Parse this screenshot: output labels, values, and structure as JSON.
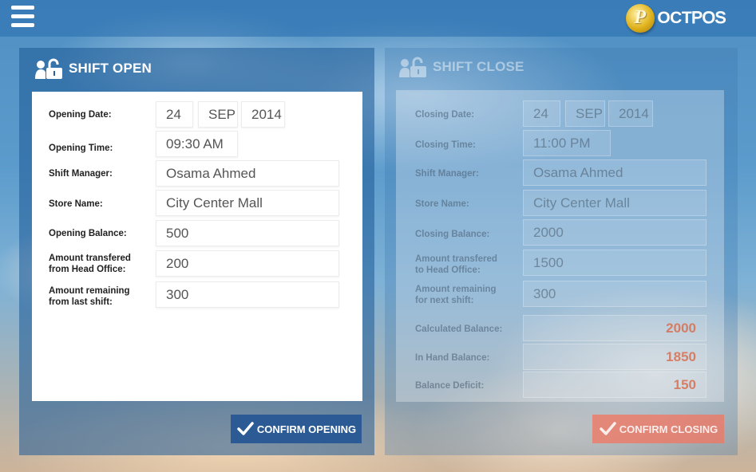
{
  "app": {
    "logo_text_a": "OCT",
    "logo_text_b": "POS"
  },
  "shift_open": {
    "title": "SHIFT OPEN",
    "opening_date": {
      "label": "Opening Date:",
      "day": "24",
      "month": "SEP",
      "year": "2014"
    },
    "opening_time": {
      "label": "Opening Time:",
      "value": "09:30 AM"
    },
    "shift_manager": {
      "label": "Shift Manager:",
      "value": "Osama Ahmed"
    },
    "store_name": {
      "label": "Store Name:",
      "value": "City Center Mall"
    },
    "opening_balance": {
      "label": "Opening Balance:",
      "value": "500"
    },
    "amount_transferred": {
      "label_1": "Amount transfered",
      "label_2": "from Head Office:",
      "value": "200"
    },
    "amount_remaining": {
      "label_1": "Amount remaining",
      "label_2": "from last shift:",
      "value": "300"
    },
    "confirm_label": "CONFIRM OPENING"
  },
  "shift_close": {
    "title": "SHIFT CLOSE",
    "closing_date": {
      "label": "Closing Date:",
      "day": "24",
      "month": "SEP",
      "year": "2014"
    },
    "closing_time": {
      "label": "Closing Time:",
      "value": "11:00 PM"
    },
    "shift_manager": {
      "label": "Shift Manager:",
      "value": "Osama Ahmed"
    },
    "store_name": {
      "label": "Store Name:",
      "value": "City Center Mall"
    },
    "closing_balance": {
      "label": "Closing Balance:",
      "value": "2000"
    },
    "amount_transferred": {
      "label_1": "Amount transfered",
      "label_2": "to Head Office:",
      "value": "1500"
    },
    "amount_remaining": {
      "label_1": "Amount remaining",
      "label_2": "for next shift:",
      "value": "300"
    },
    "calculated_balance": {
      "label": "Calculated Balance:",
      "value": "2000"
    },
    "in_hand_balance": {
      "label": "In Hand Balance:",
      "value": "1850"
    },
    "balance_deficit": {
      "label": "Balance Deficit:",
      "value": "150"
    },
    "confirm_label": "CONFIRM CLOSING"
  },
  "colors": {
    "confirm_opening_bg": "#2b5a94",
    "confirm_closing_bg": "#f07864",
    "summary_value": "#d76e50"
  },
  "icons": {
    "menu": "hamburger-menu-icon",
    "lock": "unlocked-padlock-person-icon",
    "check": "checkmark-icon"
  }
}
